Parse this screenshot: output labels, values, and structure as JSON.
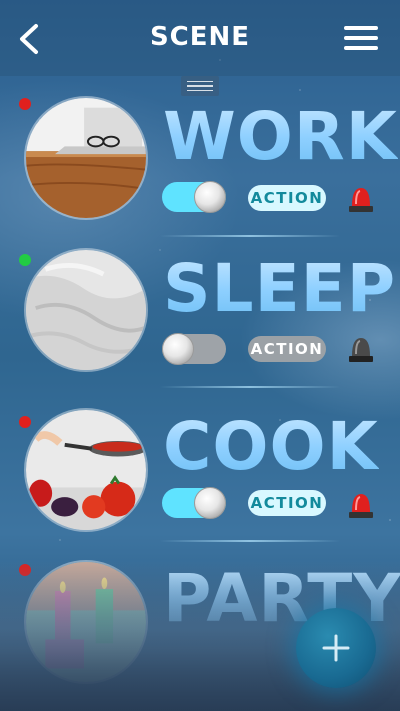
{
  "header": {
    "title": "SCENE",
    "back_icon": "chevron-left-icon",
    "menu_icon": "hamburger-menu-icon"
  },
  "scenes": [
    {
      "name": "WORK",
      "status_color": "#e0201e",
      "enabled": true,
      "action_label": "ACTION",
      "action_active": true,
      "alarm": "red-siren-icon",
      "photo": "laptop-on-desk"
    },
    {
      "name": "SLEEP",
      "status_color": "#22cc44",
      "enabled": false,
      "action_label": "ACTION",
      "action_active": false,
      "alarm": "gray-siren-icon",
      "photo": "white-bed-sheets"
    },
    {
      "name": "COOK",
      "status_color": "#e0201e",
      "enabled": true,
      "action_label": "ACTION",
      "action_active": true,
      "alarm": "red-siren-icon",
      "photo": "frying-pan-vegetables"
    },
    {
      "name": "PARTY",
      "status_color": "#e0201e",
      "photo": "candles-cupcake"
    }
  ],
  "fab": {
    "icon": "plus-icon"
  },
  "colors": {
    "toggle_on": "#5fe3ff",
    "toggle_off": "#9ea3a8",
    "accent_text": "#138a9c"
  }
}
